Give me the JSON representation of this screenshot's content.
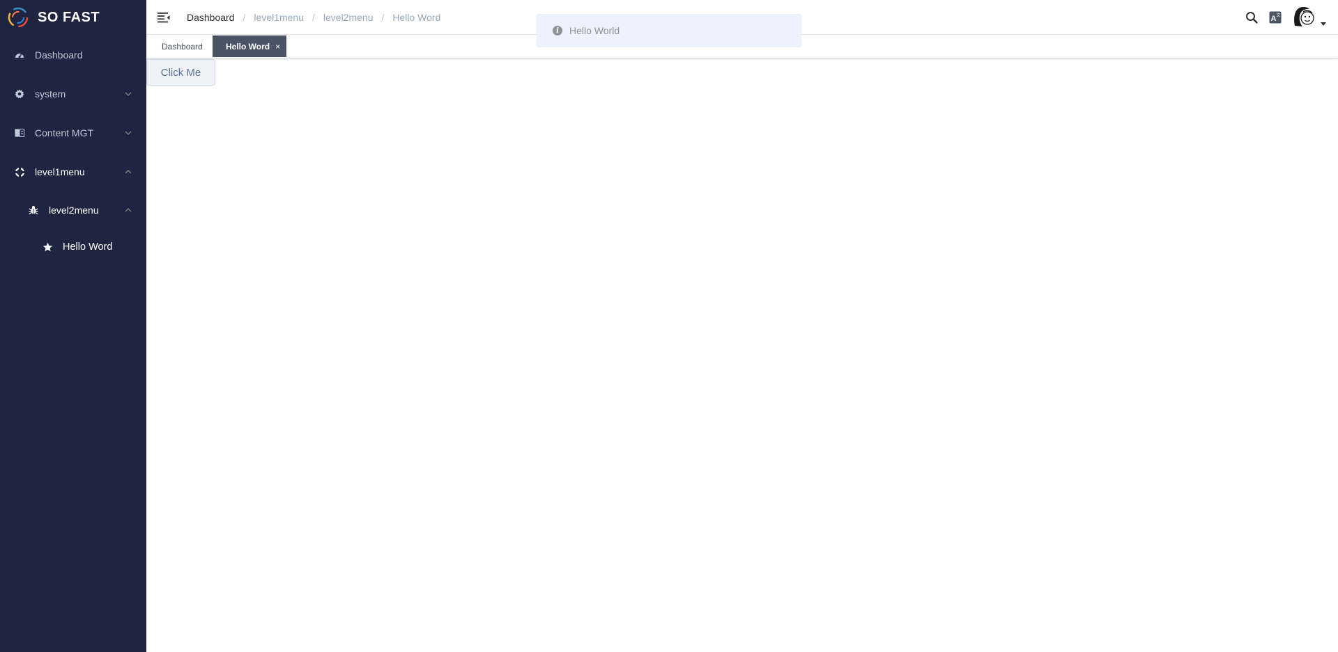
{
  "brand": {
    "name": "SO FAST"
  },
  "sidebar": {
    "items": [
      {
        "label": "Dashboard",
        "icon": "dashboard-icon"
      },
      {
        "label": "system",
        "icon": "gear-icon"
      },
      {
        "label": "Content MGT",
        "icon": "book-icon"
      },
      {
        "label": "level1menu",
        "icon": "crosshair-icon"
      },
      {
        "label": "level2menu",
        "icon": "bug-icon"
      },
      {
        "label": "Hello Word",
        "icon": "star-icon"
      }
    ]
  },
  "breadcrumb": [
    "Dashboard",
    "level1menu",
    "level2menu",
    "Hello Word"
  ],
  "breadcrumb_sep": "/",
  "tags": {
    "dashboard": "Dashboard",
    "active": "Hello Word",
    "close_glyph": "×"
  },
  "content": {
    "button_label": "Click Me"
  },
  "toast": {
    "icon": "i",
    "text": "Hello World"
  },
  "colors": {
    "sidebar_bg": "#1f2540",
    "active_tag_bg": "#4b5464",
    "toast_bg": "#edf2fc"
  }
}
